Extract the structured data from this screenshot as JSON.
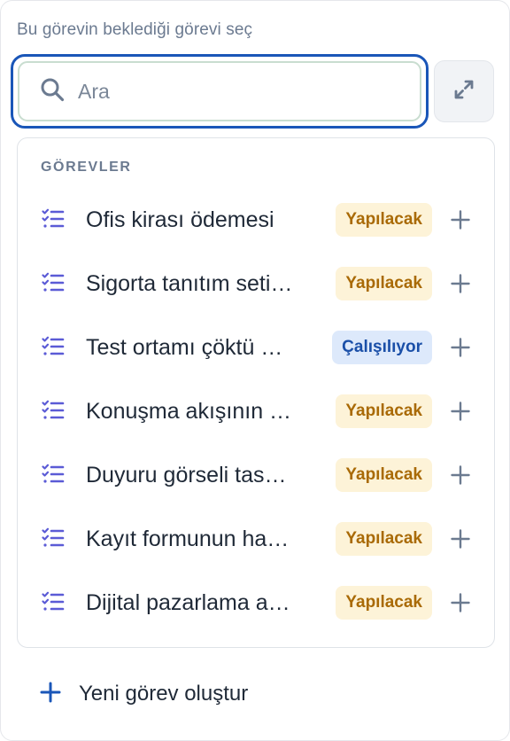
{
  "heading": "Bu görevin beklediği görevi seç",
  "search": {
    "placeholder": "Ara",
    "value": ""
  },
  "list": {
    "section_label": "GÖREVLER",
    "items": [
      {
        "title": "Ofis kirası ödemesi",
        "status": "Yapılacak",
        "status_type": "todo"
      },
      {
        "title": "Sigorta tanıtım seti…",
        "status": "Yapılacak",
        "status_type": "todo"
      },
      {
        "title": "Test ortamı çöktü …",
        "status": "Çalışılıyor",
        "status_type": "progress"
      },
      {
        "title": "Konuşma akışının …",
        "status": "Yapılacak",
        "status_type": "todo"
      },
      {
        "title": "Duyuru görseli tas…",
        "status": "Yapılacak",
        "status_type": "todo"
      },
      {
        "title": "Kayıt formunun ha…",
        "status": "Yapılacak",
        "status_type": "todo"
      },
      {
        "title": "Dijital pazarlama a…",
        "status": "Yapılacak",
        "status_type": "todo"
      }
    ]
  },
  "create_label": "Yeni görev oluştur",
  "icons": {
    "search": "search-icon",
    "expand": "expand-icon",
    "task": "task-list-icon",
    "add": "plus-icon"
  },
  "colors": {
    "focus_border": "#1a56b8",
    "task_icon": "#5b5bd6",
    "todo_bg": "#fdf3d8",
    "todo_text": "#a96a06",
    "progress_bg": "#dde9fb",
    "progress_text": "#1a4fa8",
    "create_plus": "#1a56b8"
  }
}
